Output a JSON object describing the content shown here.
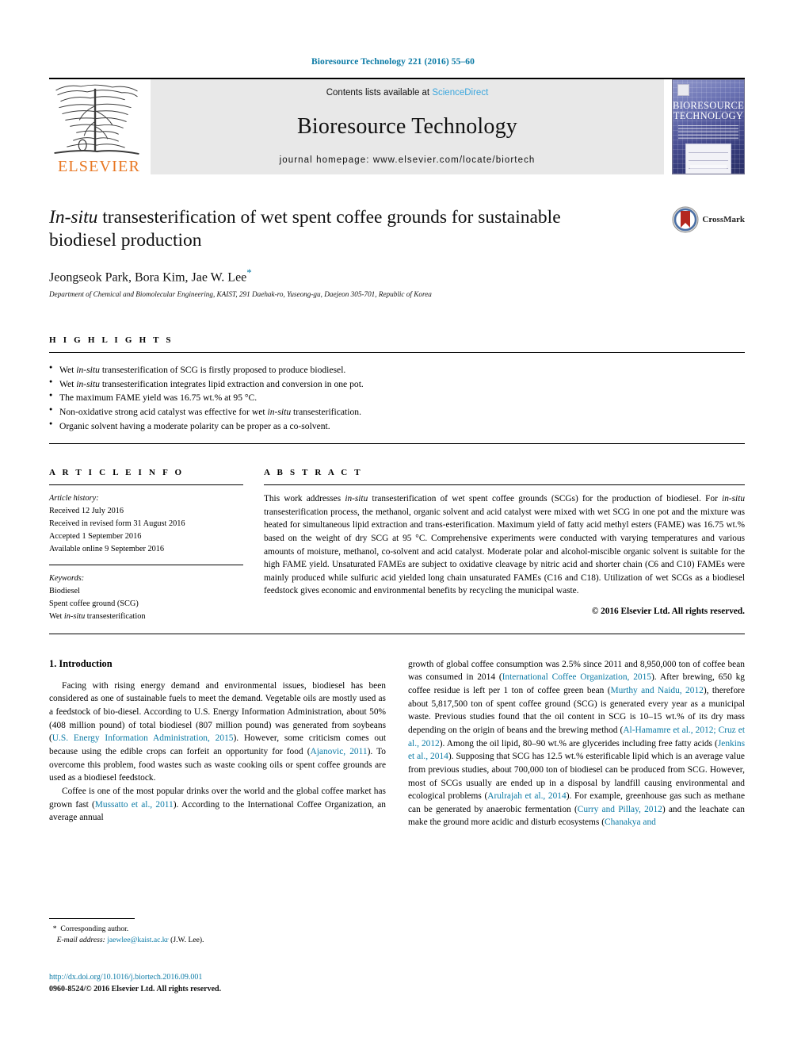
{
  "running_head": "Bioresource Technology 221 (2016) 55–60",
  "masthead": {
    "publisher": "ELSEVIER",
    "contents_prefix": "Contents lists available at ",
    "contents_link": "ScienceDirect",
    "journal_title": "Bioresource Technology",
    "homepage": "journal homepage: www.elsevier.com/locate/biortech",
    "cover_title_line1": "BIORESOURCE",
    "cover_title_line2": "TECHNOLOGY"
  },
  "article": {
    "title_italic": "In-situ",
    "title_rest": " transesterification of wet spent coffee grounds for sustainable biodiesel production",
    "authors": "Jeongseok Park, Bora Kim, Jae W. Lee",
    "corresponding_marker": "*",
    "affiliation": "Department of Chemical and Biomolecular Engineering, KAIST, 291 Daehak-ro, Yuseong-gu, Daejeon 305-701, Republic of Korea",
    "crossmark_label": "CrossMark"
  },
  "highlights": {
    "heading": "H I G H L I G H T S",
    "items": [
      {
        "pre": "Wet ",
        "it": "in-situ",
        "post": " transesterification of SCG is firstly proposed to produce biodiesel."
      },
      {
        "pre": "Wet ",
        "it": "in-situ",
        "post": " transesterification integrates lipid extraction and conversion in one pot."
      },
      {
        "pre": "The maximum FAME yield was 16.75 wt.% at 95 °C.",
        "it": "",
        "post": ""
      },
      {
        "pre": "Non-oxidative strong acid catalyst was effective for wet ",
        "it": "in-situ",
        "post": " transesterification."
      },
      {
        "pre": "Organic solvent having a moderate polarity can be proper as a co-solvent.",
        "it": "",
        "post": ""
      }
    ]
  },
  "article_info": {
    "heading": "A R T I C L E   I N F O",
    "history_label": "Article history:",
    "history": [
      "Received 12 July 2016",
      "Received in revised form 31 August 2016",
      "Accepted 1 September 2016",
      "Available online 9 September 2016"
    ],
    "keywords_label": "Keywords:",
    "keywords": [
      {
        "pre": "Biodiesel",
        "it": "",
        "post": ""
      },
      {
        "pre": "Spent coffee ground (SCG)",
        "it": "",
        "post": ""
      },
      {
        "pre": "Wet ",
        "it": "in-situ",
        "post": " transesterification"
      }
    ]
  },
  "abstract": {
    "heading": "A B S T R A C T",
    "p1_a": "This work addresses ",
    "p1_it1": "in-situ",
    "p1_b": " transesterification of wet spent coffee grounds (SCGs) for the production of biodiesel. For ",
    "p1_it2": "in-situ",
    "p1_c": " transesterification process, the methanol, organic solvent and acid catalyst were mixed with wet SCG in one pot and the mixture was heated for simultaneous lipid extraction and trans-esterification. Maximum yield of fatty acid methyl esters (FAME) was 16.75 wt.% based on the weight of dry SCG at 95 °C. Comprehensive experiments were conducted with varying temperatures and various amounts of moisture, methanol, co-solvent and acid catalyst. Moderate polar and alcohol-miscible organic solvent is suitable for the high FAME yield. Unsaturated FAMEs are subject to oxidative cleavage by nitric acid and shorter chain (C6 and C10) FAMEs were mainly produced while sulfuric acid yielded long chain unsaturated FAMEs (C16 and C18). Utilization of wet SCGs as a biodiesel feedstock gives economic and environmental benefits by recycling the municipal waste.",
    "copyright": "© 2016 Elsevier Ltd. All rights reserved."
  },
  "body": {
    "section1_heading": "1. Introduction",
    "left_p1_a": "Facing with rising energy demand and environmental issues, biodiesel has been considered as one of sustainable fuels to meet the demand. Vegetable oils are mostly used as a feedstock of bio-diesel. According to U.S. Energy Information Administration, about 50% (408 million pound) of total biodiesel (807 million pound) was generated from soybeans (",
    "left_p1_link1": "U.S. Energy Information Administration, 2015",
    "left_p1_b": "). However, some criticism comes out because using the edible crops can forfeit an opportunity for food (",
    "left_p1_link2": "Ajanovic, 2011",
    "left_p1_c": "). To overcome this problem, food wastes such as waste cooking oils or spent coffee grounds are used as a biodiesel feedstock.",
    "left_p2_a": "Coffee is one of the most popular drinks over the world and the global coffee market has grown fast (",
    "left_p2_link1": "Mussatto et al., 2011",
    "left_p2_b": "). According to the International Coffee Organization, an average annual",
    "right_p_a": "growth of global coffee consumption was 2.5% since 2011 and 8,950,000 ton of coffee bean was consumed in 2014 (",
    "right_link1": "International Coffee Organization, 2015",
    "right_p_b": "). After brewing, 650 kg coffee residue is left per 1 ton of coffee green bean (",
    "right_link2": "Murthy and Naidu, 2012",
    "right_p_c": "), therefore about 5,817,500 ton of spent coffee ground (SCG) is generated every year as a municipal waste. Previous studies found that the oil content in SCG is 10–15 wt.% of its dry mass depending on the origin of beans and the brewing method (",
    "right_link3": "Al-Hamamre et al., 2012; Cruz et al., 2012",
    "right_p_d": "). Among the oil lipid, 80–90 wt.% are glycerides including free fatty acids (",
    "right_link4": "Jenkins et al., 2014",
    "right_p_e": "). Supposing that SCG has 12.5 wt.% esterificable lipid which is an average value from previous studies, about 700,000 ton of biodiesel can be produced from SCG. However, most of SCGs usually are ended up in a disposal by landfill causing environmental and ecological problems (",
    "right_link5": "Arulrajah et al., 2014",
    "right_p_f": "). For example, greenhouse gas such as methane can be generated by anaerobic fermentation (",
    "right_link6": "Curry and Pillay, 2012",
    "right_p_g": ") and the leachate can make the ground more acidic and disturb ecosystems (",
    "right_link7": "Chanakya and"
  },
  "footer": {
    "corresponding_marker": "*",
    "corresponding_label": "Corresponding author.",
    "email_label": "E-mail address:",
    "email": "jaewlee@kaist.ac.kr",
    "email_suffix": " (J.W. Lee).",
    "doi": "http://dx.doi.org/10.1016/j.biortech.2016.09.001",
    "issn": "0960-8524/© 2016 Elsevier Ltd. All rights reserved."
  },
  "colors": {
    "link": "#0b7aa5",
    "sciencedirect": "#3ba6dd",
    "elsevier_orange": "#e87722"
  }
}
